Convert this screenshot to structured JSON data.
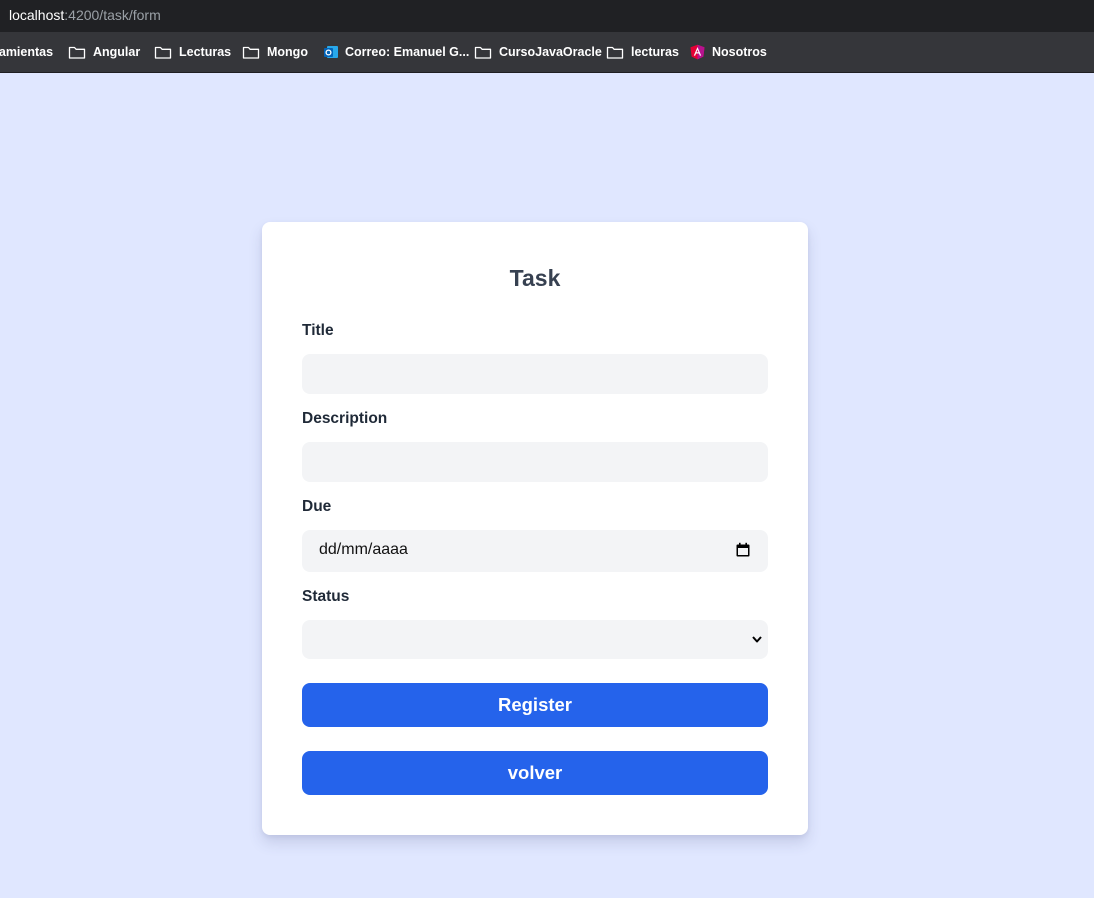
{
  "browser": {
    "url_host": "localhost",
    "url_path": ":4200/task/form",
    "bookmarks": [
      {
        "label": "ramientas",
        "icon": "none"
      },
      {
        "label": "Angular",
        "icon": "folder-icon"
      },
      {
        "label": "Lecturas",
        "icon": "folder-icon"
      },
      {
        "label": "Mongo",
        "icon": "folder-icon"
      },
      {
        "label": "Correo: Emanuel G...",
        "icon": "outlook-icon"
      },
      {
        "label": "CursoJavaOracle",
        "icon": "folder-icon"
      },
      {
        "label": "lecturas",
        "icon": "folder-icon"
      },
      {
        "label": "Nosotros",
        "icon": "angular-icon"
      }
    ]
  },
  "form": {
    "title": "Task",
    "fields": {
      "title": {
        "label": "Title",
        "value": ""
      },
      "description": {
        "label": "Description",
        "value": ""
      },
      "due": {
        "label": "Due",
        "placeholder": "dd/mm/aaaa"
      },
      "status": {
        "label": "Status",
        "selected": ""
      }
    },
    "register_label": "Register",
    "back_label": "volver"
  },
  "colors": {
    "page_bg": "#e0e7ff",
    "card_bg": "#ffffff",
    "input_bg": "#f3f4f6",
    "button_bg": "#2563eb",
    "button_text": "#ffffff",
    "heading_text": "#374151"
  }
}
